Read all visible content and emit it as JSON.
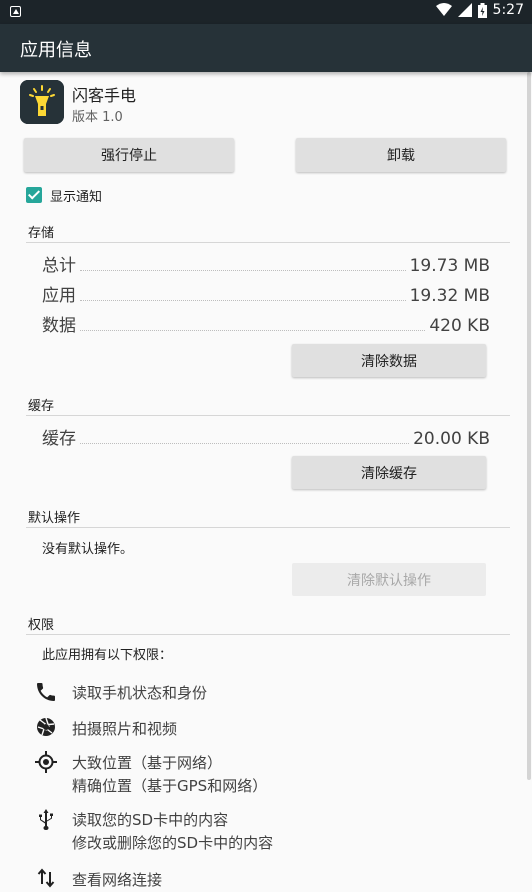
{
  "status_bar": {
    "time": "5:27"
  },
  "appbar": {
    "title": "应用信息"
  },
  "app": {
    "name": "闪客手电",
    "version": "版本 1.0"
  },
  "buttons": {
    "force_stop": "强行停止",
    "uninstall": "卸载",
    "clear_data": "清除数据",
    "clear_cache": "清除缓存",
    "clear_defaults": "清除默认操作"
  },
  "notifications": {
    "label": "显示通知",
    "checked": true
  },
  "storage": {
    "title": "存储",
    "rows": [
      {
        "label": "总计",
        "value": "19.73 MB"
      },
      {
        "label": "应用",
        "value": "19.32 MB"
      },
      {
        "label": "数据",
        "value": "420 KB"
      }
    ]
  },
  "cache": {
    "title": "缓存",
    "rows": [
      {
        "label": "缓存",
        "value": "20.00 KB"
      }
    ]
  },
  "defaults": {
    "title": "默认操作",
    "text": "没有默认操作。"
  },
  "permissions": {
    "title": "权限",
    "intro": "此应用拥有以下权限：",
    "items": [
      {
        "icon": "phone-icon",
        "lines": [
          "读取手机状态和身份"
        ]
      },
      {
        "icon": "camera-aperture-icon",
        "lines": [
          "拍摄照片和视频"
        ]
      },
      {
        "icon": "location-icon",
        "lines": [
          "大致位置（基于网络）",
          "精确位置（基于GPS和网络）"
        ]
      },
      {
        "icon": "usb-icon",
        "lines": [
          "读取您的SD卡中的内容",
          "修改或删除您的SD卡中的内容"
        ]
      },
      {
        "icon": "network-arrows-icon",
        "lines": [
          "查看网络连接"
        ]
      }
    ]
  },
  "colors": {
    "appbar": "#263238",
    "statusbar": "#1c2429",
    "accent": "#26a69a",
    "icon_yellow": "#fdd835"
  }
}
